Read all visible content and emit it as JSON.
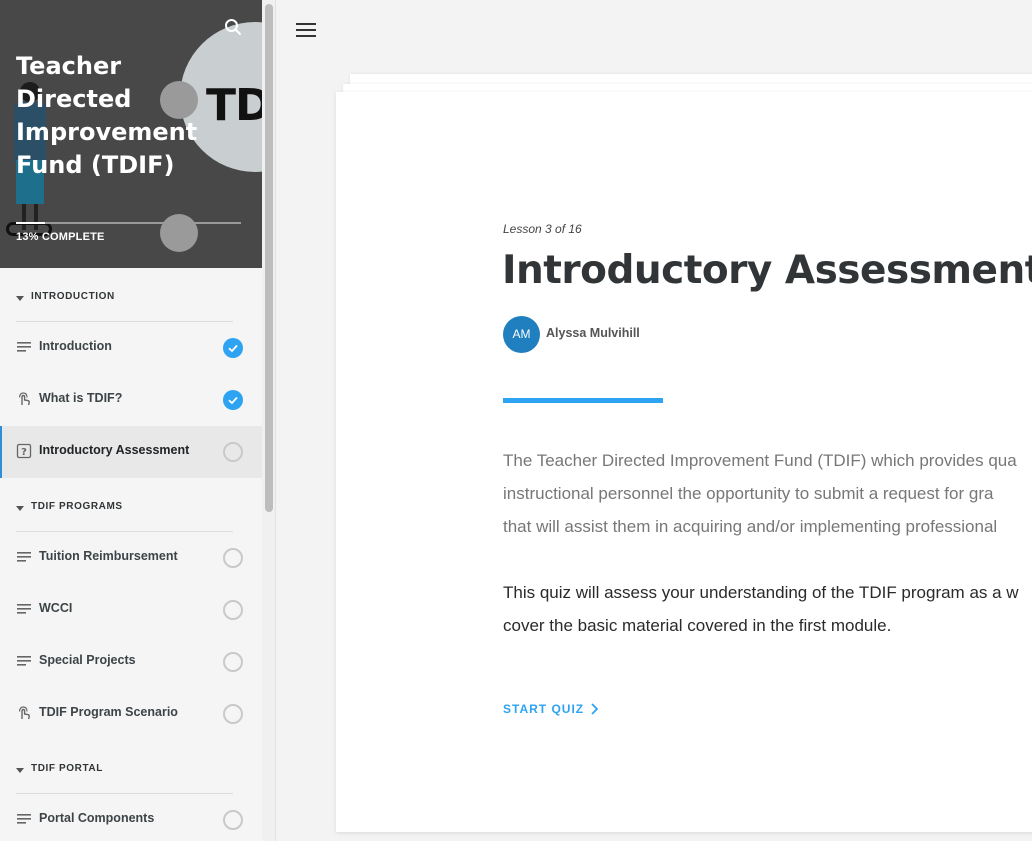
{
  "course": {
    "title": "Teacher Directed Improvement Fund (TDIF)",
    "progress_label": "13% COMPLETE",
    "progress_fraction": 0.13,
    "logo_text": "TD"
  },
  "sidebar": {
    "sections": [
      {
        "label": "INTRODUCTION",
        "lessons": [
          {
            "title": "Introduction",
            "type": "text-icon",
            "status": "complete"
          },
          {
            "title": "What is TDIF?",
            "type": "touch-icon",
            "status": "complete"
          },
          {
            "title": "Introductory Assessment",
            "type": "quiz-icon",
            "status": "incomplete",
            "active": true
          }
        ]
      },
      {
        "label": "TDIF PROGRAMS",
        "lessons": [
          {
            "title": "Tuition Reimbursement",
            "type": "text-icon",
            "status": "incomplete"
          },
          {
            "title": "WCCI",
            "type": "text-icon",
            "status": "incomplete"
          },
          {
            "title": "Special Projects",
            "type": "text-icon",
            "status": "incomplete"
          },
          {
            "title": "TDIF Program Scenario",
            "type": "touch-icon",
            "status": "incomplete"
          }
        ]
      },
      {
        "label": "TDIF PORTAL",
        "lessons": [
          {
            "title": "Portal Components",
            "type": "text-icon",
            "status": "incomplete"
          }
        ]
      }
    ]
  },
  "lesson": {
    "count_label": "Lesson 3 of 16",
    "title": "Introductory Assessment",
    "author_initials": "AM",
    "author_name": "Alyssa Mulvihill",
    "paragraph_1_lines": [
      "The Teacher Directed Improvement Fund (TDIF) which provides qua",
      "instructional personnel the opportunity to submit a request for gra",
      "that will assist them in acquiring and/or implementing professional"
    ],
    "paragraph_2_lines": [
      "This quiz will assess your understanding of the TDIF program as a w",
      "cover the basic material covered in the first module."
    ],
    "start_quiz_label": "START QUIZ"
  },
  "colors": {
    "accent": "#2ea3f2",
    "avatar": "#1f7fbf",
    "hero_bg": "#484848"
  }
}
